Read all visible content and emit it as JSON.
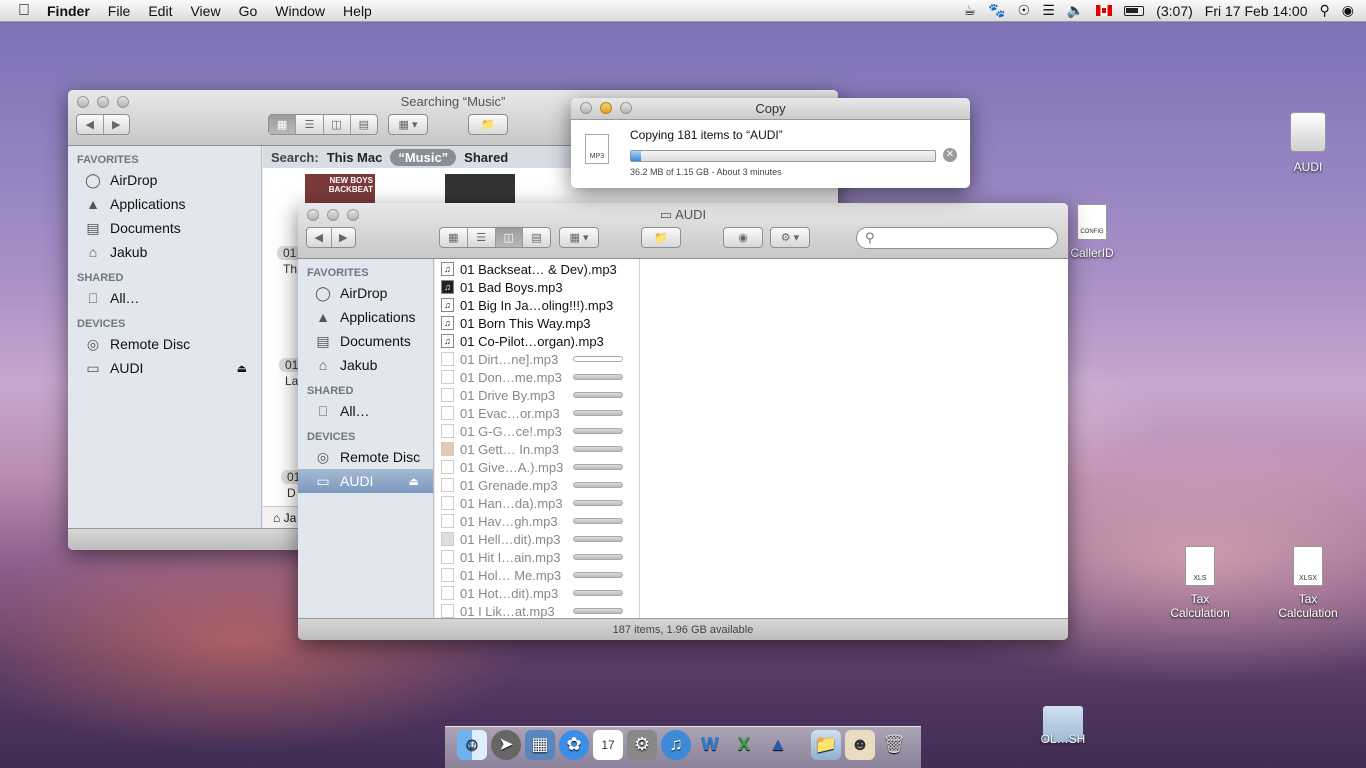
{
  "menubar": {
    "app": "Finder",
    "menus": [
      "File",
      "Edit",
      "View",
      "Go",
      "Window",
      "Help"
    ],
    "battery_time": "(3:07)",
    "clock": "Fri 17 Feb  14:00"
  },
  "search_window": {
    "title": "Searching “Music”",
    "scope_label": "Search:",
    "scopes": [
      "This Mac",
      "“Music”",
      "Shared"
    ],
    "sidebar": {
      "favorites_header": "FAVORITES",
      "favorites": [
        "AirDrop",
        "Applications",
        "Documents",
        "Jakub"
      ],
      "shared_header": "SHARED",
      "shared": [
        "All…"
      ],
      "devices_header": "DEVICES",
      "devices": [
        "Remote Disc",
        "AUDI"
      ]
    },
    "thumb_label": "NEW BOYS BACKBEAT",
    "partial_labels": [
      "01",
      "Th",
      "01",
      "La",
      "01",
      "D"
    ],
    "path_fragment": "Ja"
  },
  "copy_dialog": {
    "title": "Copy",
    "message": "Copying 181 items to “AUDI”",
    "detail": "36.2 MB of 1.15 GB - About 3 minutes",
    "progress": 0.032,
    "file_badge": "MP3"
  },
  "audi_window": {
    "title": "AUDI",
    "sidebar": {
      "favorites_header": "FAVORITES",
      "favorites": [
        "AirDrop",
        "Applications",
        "Documents",
        "Jakub"
      ],
      "shared_header": "SHARED",
      "shared": [
        "All…"
      ],
      "devices_header": "DEVICES",
      "devices": [
        "Remote Disc",
        "AUDI"
      ]
    },
    "files": [
      {
        "name": "01 Backseat… & Dev).mp3",
        "state": "done"
      },
      {
        "name": "01 Bad Boys.mp3",
        "state": "done"
      },
      {
        "name": "01 Big In Ja…oling!!!).mp3",
        "state": "done"
      },
      {
        "name": "01 Born This Way.mp3",
        "state": "done"
      },
      {
        "name": "01 Co-Pilot…organ).mp3",
        "state": "done"
      },
      {
        "name": "01 Dirt…ne].mp3",
        "state": "copying"
      },
      {
        "name": "01 Don…me.mp3",
        "state": "pending"
      },
      {
        "name": "01 Drive By.mp3",
        "state": "pending"
      },
      {
        "name": "01 Evac…or.mp3",
        "state": "pending"
      },
      {
        "name": "01 G-G…ce!.mp3",
        "state": "pending"
      },
      {
        "name": "01 Gett… In.mp3",
        "state": "pending"
      },
      {
        "name": "01 Give…A.).mp3",
        "state": "pending"
      },
      {
        "name": "01 Grenade.mp3",
        "state": "pending"
      },
      {
        "name": "01 Han…da).mp3",
        "state": "pending"
      },
      {
        "name": "01 Hav…gh.mp3",
        "state": "pending"
      },
      {
        "name": "01 Hell…dit).mp3",
        "state": "pending"
      },
      {
        "name": "01 Hit I…ain.mp3",
        "state": "pending"
      },
      {
        "name": "01 Hol… Me.mp3",
        "state": "pending"
      },
      {
        "name": "01 Hot…dit).mp3",
        "state": "pending"
      },
      {
        "name": "01 I Lik…at.mp3",
        "state": "pending"
      }
    ],
    "status": "187 items, 1.96 GB available"
  },
  "desktop": {
    "audi": "AUDI",
    "callerid": "CallerID",
    "config_badge": "CONFIG",
    "tax1": "Tax Calculation",
    "tax1_badge": "XLS",
    "tax2": "Tax Calculation",
    "tax2_badge": "XLSX",
    "folder": "OL…SH"
  }
}
